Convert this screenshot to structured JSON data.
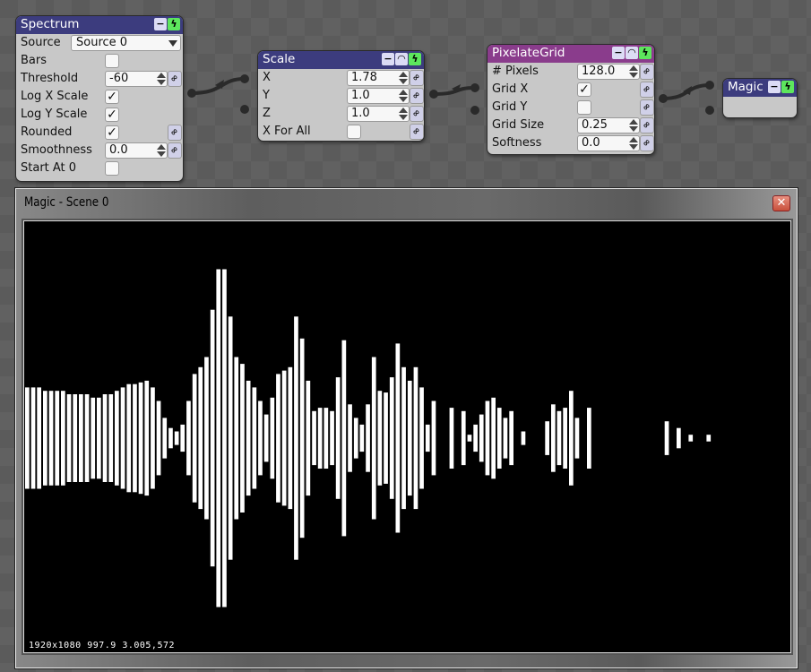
{
  "nodes": {
    "spectrum": {
      "title": "Spectrum",
      "source_label": "Source",
      "source_value": "Source 0",
      "bars_label": "Bars",
      "bars": false,
      "threshold_label": "Threshold",
      "threshold": "-60",
      "logx_label": "Log X Scale",
      "logx": true,
      "logy_label": "Log Y Scale",
      "logy": true,
      "rounded_label": "Rounded",
      "rounded": true,
      "smooth_label": "Smoothness",
      "smooth": "0.0",
      "start_label": "Start At 0",
      "start": false
    },
    "scale": {
      "title": "Scale",
      "x_label": "X",
      "x": "1.78",
      "y_label": "Y",
      "y": "1.0",
      "z_label": "Z",
      "z": "1.0",
      "xall_label": "X For All",
      "xall": false
    },
    "pixelate": {
      "title": "PixelateGrid",
      "pixels_label": "# Pixels",
      "pixels": "128.0",
      "gridx_label": "Grid X",
      "gridx": true,
      "gridy_label": "Grid Y",
      "gridy": false,
      "size_label": "Grid Size",
      "size": "0.25",
      "soft_label": "Softness",
      "soft": "0.0"
    },
    "magic": {
      "title": "Magic"
    }
  },
  "header_icons": {
    "minimize": "minus-icon",
    "eye": "visibility-icon",
    "enabled": "lightning-icon"
  },
  "colors": {
    "node_header": "#3c3c7e",
    "pixelate_header": "#8a3c8c",
    "enabled": "#5de65d"
  },
  "window": {
    "title": "Magic - Scene 0",
    "status": "1920x1080 997.9 3.005,572"
  },
  "viewport": {
    "bar_color": "#ffffff",
    "amplitudes": [
      0.3,
      0.3,
      0.3,
      0.28,
      0.28,
      0.28,
      0.28,
      0.26,
      0.26,
      0.26,
      0.26,
      0.24,
      0.24,
      0.26,
      0.26,
      0.28,
      0.3,
      0.32,
      0.32,
      0.33,
      0.34,
      0.3,
      0.22,
      0.12,
      0.06,
      0.04,
      0.08,
      0.22,
      0.38,
      0.42,
      0.48,
      0.76,
      1,
      1,
      0.72,
      0.48,
      0.44,
      0.34,
      0.3,
      0.22,
      0.14,
      0.24,
      0.38,
      0.4,
      0.42,
      0.72,
      0.59,
      0.34,
      0.16,
      0.18,
      0.18,
      0.16,
      0.36,
      0.58,
      0.2,
      0.12,
      0.08,
      0.2,
      0.48,
      0.28,
      0.27,
      0.36,
      0.56,
      0.42,
      0.34,
      0.42,
      0.3,
      0.08,
      0.22,
      0,
      0,
      0.18,
      0,
      0.16,
      0.02,
      0.08,
      0.14,
      0.22,
      0.24,
      0.18,
      0.12,
      0.16,
      0,
      0.04,
      0,
      0,
      0,
      0.1,
      0.2,
      0.16,
      0.18,
      0.28,
      0.12,
      0,
      0.18,
      0,
      0,
      0,
      0,
      0,
      0,
      0,
      0,
      0,
      0,
      0,
      0,
      0.1,
      0,
      0.06,
      0,
      0.02,
      0,
      0,
      0.02
    ]
  }
}
